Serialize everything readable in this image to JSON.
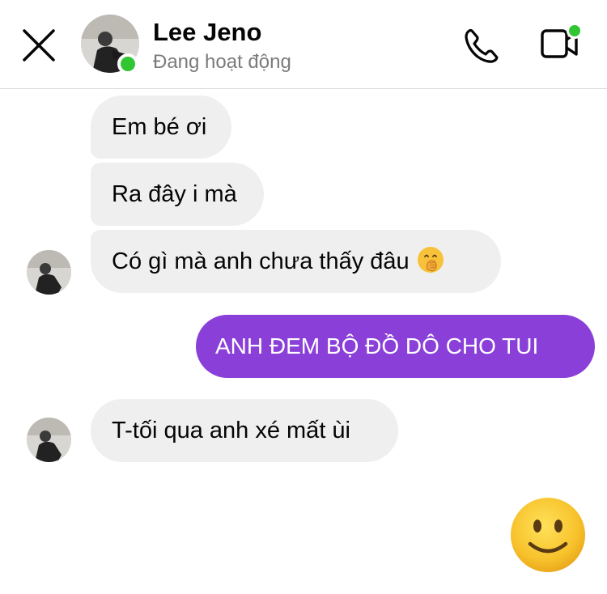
{
  "header": {
    "contact_name": "Lee Jeno",
    "status": "Đang hoạt động",
    "online_color": "#31c531",
    "icons": [
      "close-icon",
      "phone-icon",
      "video-camera-icon"
    ]
  },
  "messages": [
    {
      "sender": "contact",
      "text": "Em bé ơi"
    },
    {
      "sender": "contact",
      "text": "Ra đây i mà"
    },
    {
      "sender": "contact",
      "text": "Có gì mà anh chưa thấy đâu",
      "emoji": "face-with-hand-over-mouth"
    },
    {
      "sender": "me",
      "text": "ANH ĐEM BỘ ĐỒ DÔ CHO TUI"
    },
    {
      "sender": "contact",
      "text": "T-tối qua anh xé mất ùi"
    },
    {
      "sender": "me",
      "emoji": "slightly-smiling-face"
    }
  ],
  "colors": {
    "outgoing_bubble": "#8a3fd9",
    "incoming_bubble": "#efefef",
    "divider": "#dcdcdc"
  }
}
